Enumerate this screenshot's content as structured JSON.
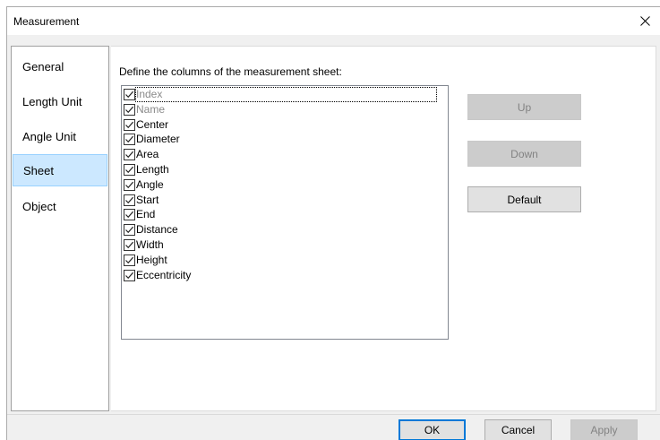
{
  "window": {
    "title": "Measurement"
  },
  "nav": {
    "items": [
      {
        "label": "General",
        "selected": false
      },
      {
        "label": "Length Unit",
        "selected": false
      },
      {
        "label": "Angle Unit",
        "selected": false
      },
      {
        "label": "Sheet",
        "selected": true
      },
      {
        "label": "Object",
        "selected": false
      }
    ]
  },
  "sheet": {
    "instruction": "Define the columns of the measurement sheet:",
    "columns": [
      {
        "label": "Index",
        "checked": true,
        "enabled": false
      },
      {
        "label": "Name",
        "checked": true,
        "enabled": false
      },
      {
        "label": "Center",
        "checked": true,
        "enabled": true
      },
      {
        "label": "Diameter",
        "checked": true,
        "enabled": true
      },
      {
        "label": "Area",
        "checked": true,
        "enabled": true
      },
      {
        "label": "Length",
        "checked": true,
        "enabled": true
      },
      {
        "label": "Angle",
        "checked": true,
        "enabled": true
      },
      {
        "label": "Start",
        "checked": true,
        "enabled": true
      },
      {
        "label": "End",
        "checked": true,
        "enabled": true
      },
      {
        "label": "Distance",
        "checked": true,
        "enabled": true
      },
      {
        "label": "Width",
        "checked": true,
        "enabled": true
      },
      {
        "label": "Height",
        "checked": true,
        "enabled": true
      },
      {
        "label": "Eccentricity",
        "checked": true,
        "enabled": true
      }
    ],
    "buttons": {
      "up": {
        "label": "Up",
        "enabled": false
      },
      "down": {
        "label": "Down",
        "enabled": false
      },
      "default": {
        "label": "Default",
        "enabled": true
      }
    }
  },
  "footer": {
    "ok": {
      "label": "OK",
      "enabled": true
    },
    "cancel": {
      "label": "Cancel",
      "enabled": true
    },
    "apply": {
      "label": "Apply",
      "enabled": false
    }
  },
  "icons": {
    "close": "close-icon",
    "check": "checkmark-icon"
  }
}
